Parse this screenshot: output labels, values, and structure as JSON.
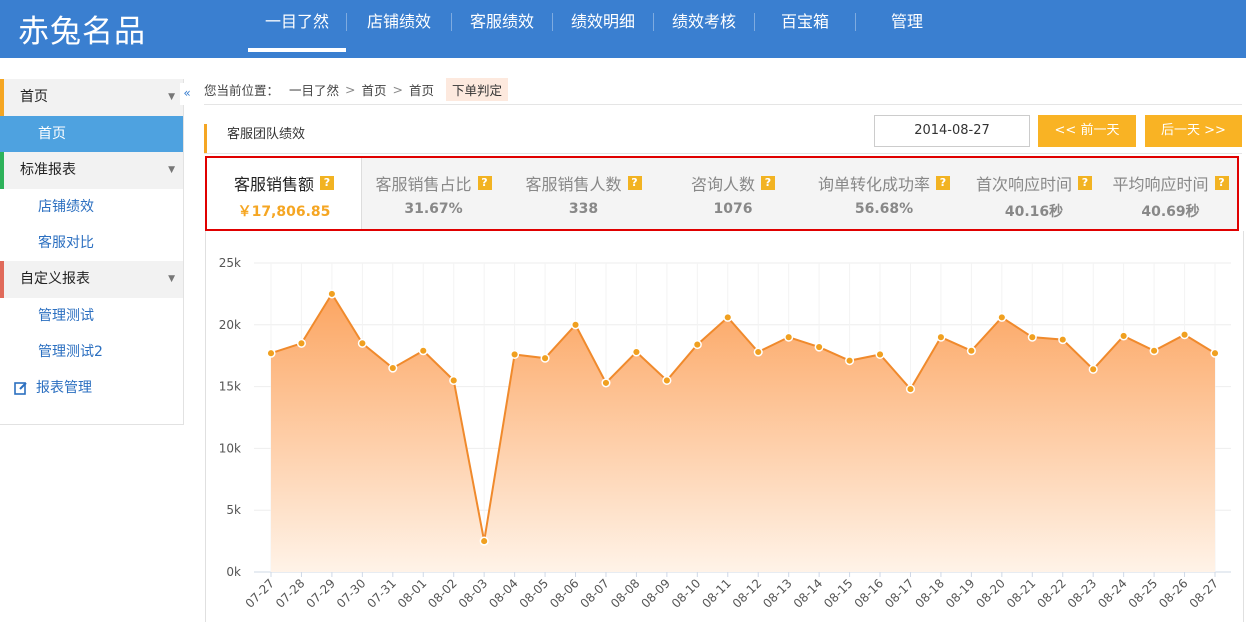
{
  "app": {
    "logo": "赤兔名品"
  },
  "nav": {
    "items": [
      "一目了然",
      "店铺绩效",
      "客服绩效",
      "绩效明细",
      "绩效考核",
      "百宝箱",
      "管理"
    ],
    "active": 0
  },
  "sidebar": {
    "collapse": "«",
    "groups": [
      {
        "label": "首页",
        "color": "#f5a623",
        "items": [
          "首页"
        ]
      },
      {
        "label": "标准报表",
        "color": "#2db25a",
        "items": [
          "店铺绩效",
          "客服对比"
        ]
      },
      {
        "label": "自定义报表",
        "color": "#e06a5a",
        "items": [
          "管理测试",
          "管理测试2"
        ]
      }
    ],
    "manage": "报表管理"
  },
  "breadcrumb": {
    "prefix": "您当前位置：",
    "parts": [
      "一目了然",
      "首页",
      "首页"
    ],
    "tag": "下单判定"
  },
  "panel": {
    "tab": "客服团队绩效",
    "date": "2014-08-27",
    "prev": "<< 前一天",
    "next": "后一天 >>"
  },
  "kpis": [
    {
      "label": "客服销售额",
      "value": "￥17,806.85"
    },
    {
      "label": "客服销售占比",
      "value": "31.67%"
    },
    {
      "label": "客服销售人数",
      "value": "338"
    },
    {
      "label": "咨询人数",
      "value": "1076"
    },
    {
      "label": "询单转化成功率",
      "value": "56.68%"
    },
    {
      "label": "首次响应时间",
      "value": "40.16秒"
    },
    {
      "label": "平均响应时间",
      "value": "40.69秒"
    }
  ],
  "kpi_help": "?",
  "chart_data": {
    "type": "area",
    "categories": [
      "07-27",
      "07-28",
      "07-29",
      "07-30",
      "07-31",
      "08-01",
      "08-02",
      "08-03",
      "08-04",
      "08-05",
      "08-06",
      "08-07",
      "08-08",
      "08-09",
      "08-10",
      "08-11",
      "08-12",
      "08-13",
      "08-14",
      "08-15",
      "08-16",
      "08-17",
      "08-18",
      "08-19",
      "08-20",
      "08-21",
      "08-22",
      "08-23",
      "08-24",
      "08-25",
      "08-26",
      "08-27"
    ],
    "values": [
      17700,
      18500,
      22500,
      18500,
      16500,
      17900,
      15500,
      2500,
      17600,
      17300,
      20000,
      15300,
      17800,
      15500,
      18400,
      20600,
      17800,
      19000,
      18200,
      17100,
      17600,
      14800,
      19000,
      17900,
      20600,
      19000,
      18800,
      16400,
      19100,
      17900,
      19200,
      17700
    ],
    "ylim": [
      0,
      25000
    ],
    "yticks": [
      "0k",
      "5k",
      "10k",
      "15k",
      "20k",
      "25k"
    ],
    "grid": true,
    "colors": {
      "top": "#fca561",
      "bottom": "#fff3e8",
      "line": "#f08a2c",
      "point": "#f0a020"
    }
  }
}
